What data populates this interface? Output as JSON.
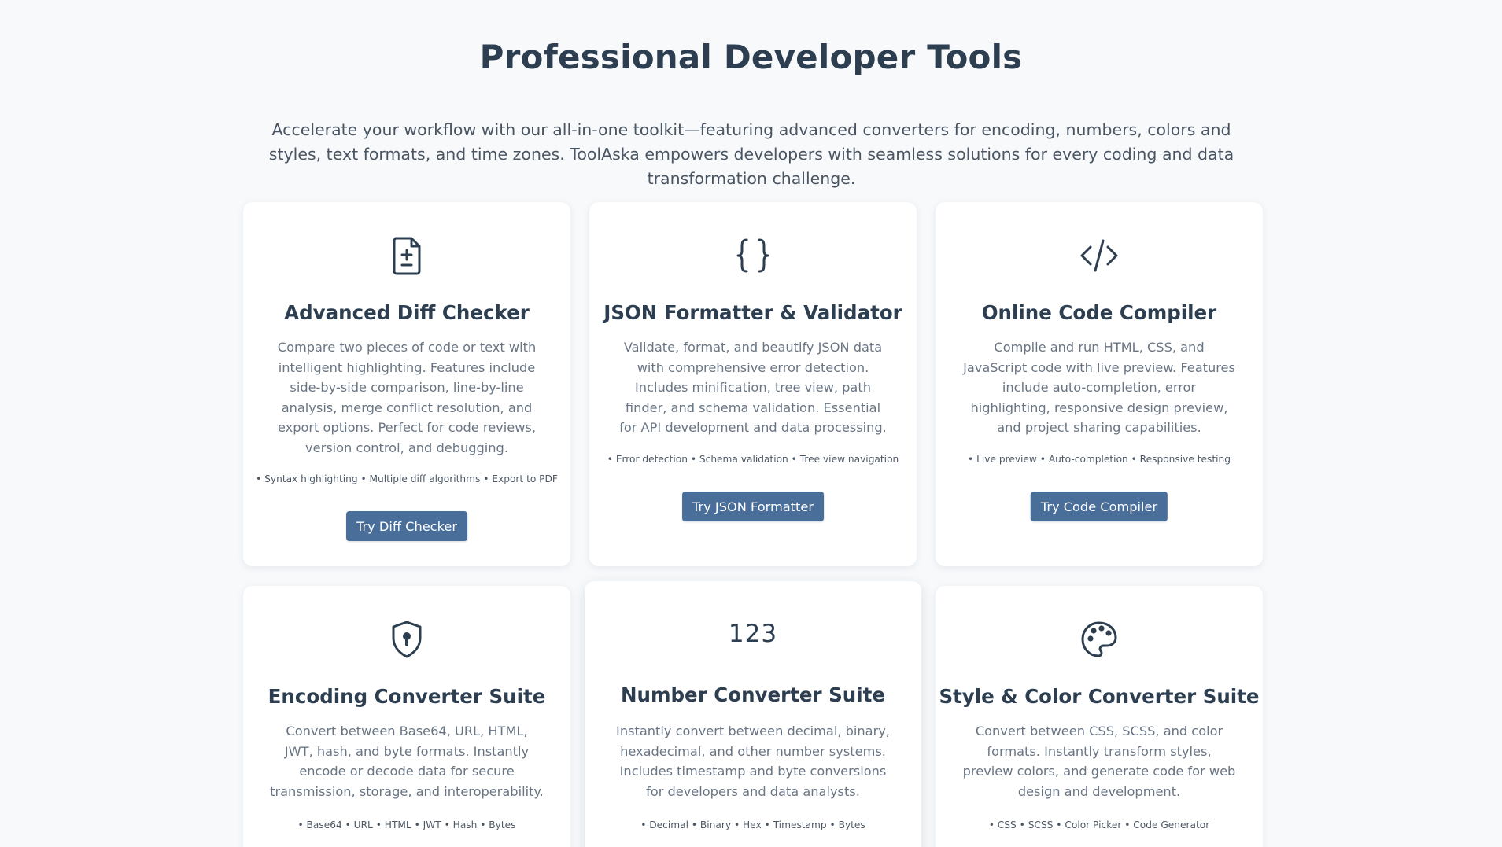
{
  "header": {
    "title": "Professional Developer Tools",
    "intro": "Accelerate your workflow with our all-in-one toolkit—featuring advanced converters for encoding, numbers, colors and styles, text formats, and time zones. ToolAska empowers developers with seamless solutions for every coding and data transformation challenge."
  },
  "cards": [
    {
      "icon": "file-diff-icon",
      "title": "Advanced Diff Checker",
      "description": "Compare two pieces of code or text with intelligent highlighting. Features include side-by-side comparison, line-by-line analysis, merge conflict resolution, and export options. Perfect for code reviews, version control, and debugging.",
      "features": "• Syntax highlighting • Multiple diff algorithms • Export to PDF",
      "button": "Try Diff Checker"
    },
    {
      "icon": "braces-icon",
      "title": "JSON Formatter & Validator",
      "description": "Validate, format, and beautify JSON data with comprehensive error detection. Includes minification, tree view, path finder, and schema validation. Essential for API development and data processing.",
      "features": "• Error detection • Schema validation • Tree view navigation",
      "button": "Try JSON Formatter"
    },
    {
      "icon": "code-icon",
      "title": "Online Code Compiler",
      "description": "Compile and run HTML, CSS, and JavaScript code with live preview. Features include auto-completion, error highlighting, responsive design preview, and project sharing capabilities.",
      "features": "• Live preview • Auto-completion • Responsive testing",
      "button": "Try Code Compiler"
    },
    {
      "icon": "shield-keyhole-icon",
      "title": "Encoding Converter Suite",
      "description": "Convert between Base64, URL, HTML, JWT, hash, and byte formats. Instantly encode or decode data for secure transmission, storage, and interoperability.",
      "features": "• Base64 • URL • HTML • JWT • Hash • Bytes"
    },
    {
      "icon_text": "123",
      "title": "Number Converter Suite",
      "description": "Instantly convert between decimal, binary, hexadecimal, and other number systems. Includes timestamp and byte conversions for developers and data analysts.",
      "features": "• Decimal • Binary • Hex • Timestamp • Bytes"
    },
    {
      "icon": "palette-icon",
      "title": "Style & Color Converter Suite",
      "description": "Convert between CSS, SCSS, and color formats. Instantly transform styles, preview colors, and generate code for web design and development.",
      "features": "• CSS • SCSS • Color Picker • Code Generator"
    }
  ],
  "colors": {
    "background": "#f7f9fb",
    "heading": "#2c3e50",
    "text_muted": "#697584",
    "button": "#4a6e9a"
  }
}
